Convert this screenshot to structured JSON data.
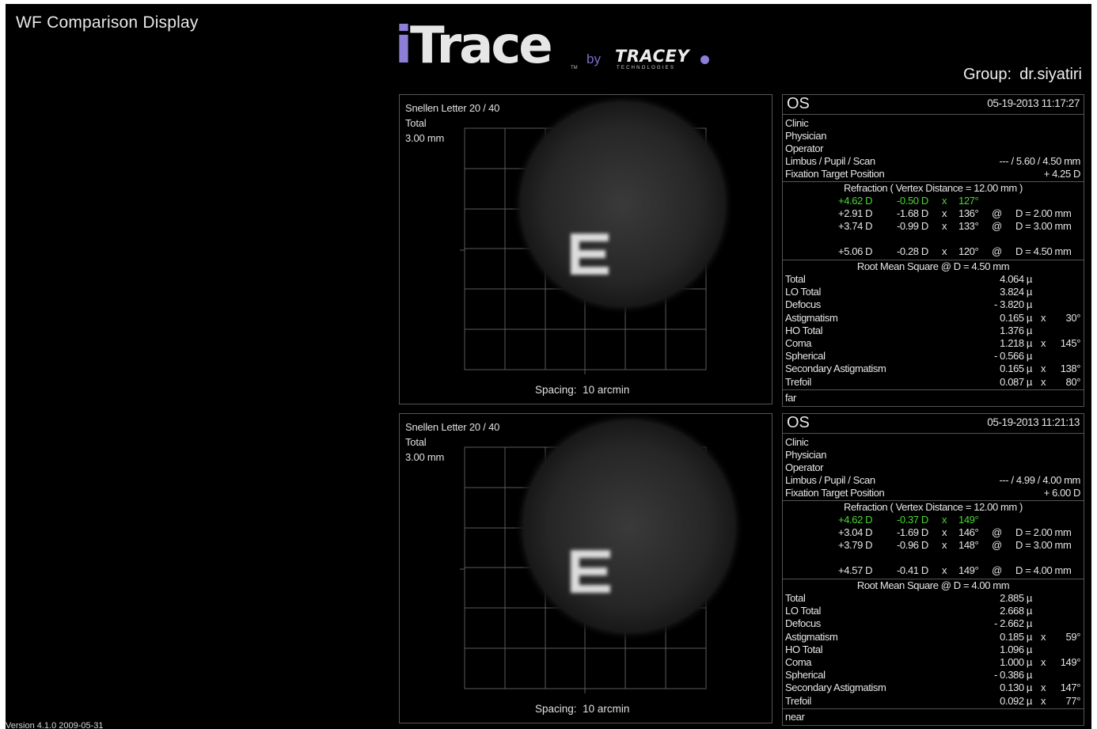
{
  "window_title": "WF Comparison Display",
  "version": "Version 4.1.0 2009-05-31",
  "logo": {
    "itrace": "Trace",
    "i": "i",
    "by": "by",
    "tracey": "TRACEY",
    "tech": "TECHNOLOGIES",
    "tm": "TM"
  },
  "group": {
    "label": "Group:",
    "value": "dr.siyatiri"
  },
  "panels": [
    {
      "snellen": "Snellen Letter 20 / 40",
      "type": "Total",
      "size": "3.00 mm",
      "spacing_label": "Spacing:",
      "spacing_value": "10 arcmin",
      "eye": "OS",
      "datetime": "05-19-2013  11:17:27",
      "clinic": "Clinic",
      "physician": "Physician",
      "operator": "Operator",
      "limbus_label": "Limbus / Pupil / Scan",
      "limbus_value": "--- / 5.60 / 4.50 mm",
      "fixation_label": "Fixation Target Position",
      "fixation_value": "+ 4.25 D",
      "refraction_title": "Refraction   ( Vertex Distance = 12.00 mm )",
      "refraction": [
        {
          "sph": "+4.62 D",
          "cyl": "-0.50 D",
          "x": "x",
          "axis": "127°",
          "at": "",
          "d": "",
          "highlight": true
        },
        {
          "sph": "+2.91 D",
          "cyl": "-1.68 D",
          "x": "x",
          "axis": "136°",
          "at": "@",
          "d": "D = 2.00 mm",
          "highlight": false
        },
        {
          "sph": "+3.74 D",
          "cyl": "-0.99 D",
          "x": "x",
          "axis": "133°",
          "at": "@",
          "d": "D = 3.00 mm",
          "highlight": false
        },
        {
          "sph": "+5.06 D",
          "cyl": "-0.28 D",
          "x": "x",
          "axis": "120°",
          "at": "@",
          "d": "D = 4.50 mm",
          "highlight": false
        }
      ],
      "rms_title": "Root Mean Square @ D = 4.50 mm",
      "rms": [
        {
          "label": "Total",
          "value": "4.064 µ",
          "x": "",
          "axis": ""
        },
        {
          "label": "LO Total",
          "value": "3.824 µ",
          "x": "",
          "axis": ""
        },
        {
          "label": "Defocus",
          "value": "- 3.820 µ",
          "x": "",
          "axis": ""
        },
        {
          "label": "Astigmatism",
          "value": "0.165 µ",
          "x": "x",
          "axis": "30°"
        },
        {
          "label": "HO Total",
          "value": "1.376 µ",
          "x": "",
          "axis": ""
        },
        {
          "label": "Coma",
          "value": "1.218 µ",
          "x": "x",
          "axis": "145°"
        },
        {
          "label": "Spherical",
          "value": "- 0.566 µ",
          "x": "",
          "axis": ""
        },
        {
          "label": "Secondary Astigmatism",
          "value": "0.165 µ",
          "x": "x",
          "axis": "138°"
        },
        {
          "label": "Trefoil",
          "value": "0.087 µ",
          "x": "x",
          "axis": "80°"
        }
      ],
      "note": "far"
    },
    {
      "snellen": "Snellen Letter 20 / 40",
      "type": "Total",
      "size": "3.00 mm",
      "spacing_label": "Spacing:",
      "spacing_value": "10 arcmin",
      "eye": "OS",
      "datetime": "05-19-2013  11:21:13",
      "clinic": "Clinic",
      "physician": "Physician",
      "operator": "Operator",
      "limbus_label": "Limbus / Pupil / Scan",
      "limbus_value": "--- / 4.99 / 4.00 mm",
      "fixation_label": "Fixation Target Position",
      "fixation_value": "+ 6.00 D",
      "refraction_title": "Refraction   ( Vertex Distance = 12.00 mm )",
      "refraction": [
        {
          "sph": "+4.62 D",
          "cyl": "-0.37 D",
          "x": "x",
          "axis": "149°",
          "at": "",
          "d": "",
          "highlight": true
        },
        {
          "sph": "+3.04 D",
          "cyl": "-1.69 D",
          "x": "x",
          "axis": "146°",
          "at": "@",
          "d": "D = 2.00 mm",
          "highlight": false
        },
        {
          "sph": "+3.79 D",
          "cyl": "-0.96 D",
          "x": "x",
          "axis": "148°",
          "at": "@",
          "d": "D = 3.00 mm",
          "highlight": false
        },
        {
          "sph": "+4.57 D",
          "cyl": "-0.41 D",
          "x": "x",
          "axis": "149°",
          "at": "@",
          "d": "D = 4.00 mm",
          "highlight": false
        }
      ],
      "rms_title": "Root Mean Square @ D = 4.00 mm",
      "rms": [
        {
          "label": "Total",
          "value": "2.885 µ",
          "x": "",
          "axis": ""
        },
        {
          "label": "LO Total",
          "value": "2.668 µ",
          "x": "",
          "axis": ""
        },
        {
          "label": "Defocus",
          "value": "- 2.662 µ",
          "x": "",
          "axis": ""
        },
        {
          "label": "Astigmatism",
          "value": "0.185 µ",
          "x": "x",
          "axis": "59°"
        },
        {
          "label": "HO Total",
          "value": "1.096 µ",
          "x": "",
          "axis": ""
        },
        {
          "label": "Coma",
          "value": "1.000 µ",
          "x": "x",
          "axis": "149°"
        },
        {
          "label": "Spherical",
          "value": "- 0.386 µ",
          "x": "",
          "axis": ""
        },
        {
          "label": "Secondary Astigmatism",
          "value": "0.130 µ",
          "x": "x",
          "axis": "147°"
        },
        {
          "label": "Trefoil",
          "value": "0.092 µ",
          "x": "x",
          "axis": "77°"
        }
      ],
      "note": "near"
    }
  ]
}
